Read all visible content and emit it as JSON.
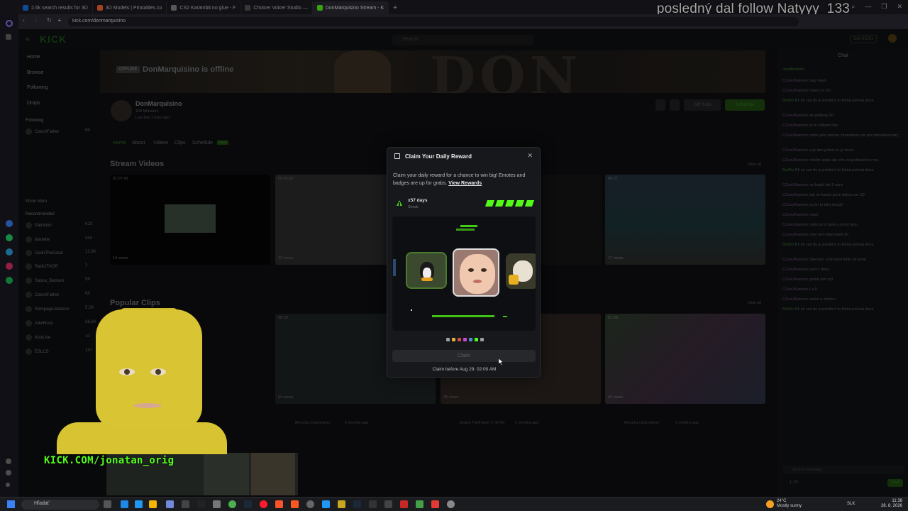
{
  "browser": {
    "tabs": [
      {
        "title": "2.6k search results for 3D",
        "color": "#1a73e8"
      },
      {
        "title": "3D Models | Printables.co",
        "color": "#fa6831"
      },
      {
        "title": "CS2 Karambit no glue - F",
        "color": "#888888"
      },
      {
        "title": "Choicer Voicer Studio —",
        "color": "#555555"
      },
      {
        "title": "DonMarquisino Stream - K",
        "color": "#53fc18"
      }
    ],
    "url": "kick.com/donmarquisino"
  },
  "overlay_text": "posledný dal follow Natyyy_133",
  "site": {
    "logo": "KICK",
    "search_placeholder": "Search",
    "nav": {
      "home": "Home",
      "browse": "Browse",
      "following": "Following",
      "drops": "Drops"
    },
    "following_header": "Following",
    "following": [
      {
        "name": "CzechFather",
        "count": "69"
      }
    ],
    "show_more": "Show More",
    "recommended_header": "Recommended",
    "recommended": [
      {
        "name": "Patrikturi",
        "count": "619"
      },
      {
        "name": "bladette",
        "count": "444"
      },
      {
        "name": "DeanTheGreat",
        "count": "12.8K"
      },
      {
        "name": "RadioTHOR",
        "count": "3"
      },
      {
        "name": "Sasou_Batman",
        "count": "58"
      },
      {
        "name": "CzechFather",
        "count": "68"
      },
      {
        "name": "RampageJackson",
        "count": "5.2K"
      },
      {
        "name": "AdinRoss",
        "count": "28.6K"
      },
      {
        "name": "KickLive",
        "count": "10"
      },
      {
        "name": "ESLCS",
        "count": "147"
      }
    ],
    "channel": {
      "offline_badge": "OFFLINE",
      "offline_title": "DonMarquisino is offline",
      "banner_text": "DON",
      "name": "DonMarquisino",
      "followers": "100 followers",
      "last_live": "Last live 1 hour ago",
      "tabs": [
        "Home",
        "About",
        "Videos",
        "Clips",
        "Schedule"
      ],
      "new_badge": "NEW",
      "gift_subs": "Gift Subs",
      "subscribe": "Subscribe"
    },
    "stream_videos": {
      "title": "Stream Videos",
      "view_all": "View all",
      "items": [
        {
          "duration": "01:07:43",
          "views": "14 views"
        },
        {
          "duration": "05:45:02",
          "views": "33 views"
        },
        {
          "duration": "00:37",
          "views": "17 views"
        }
      ]
    },
    "popular_clips": {
      "title": "Popular Clips",
      "view_all": "View all",
      "items": [
        {
          "duration": "00:30",
          "views": "64 views",
          "tag": "Mencha Chameleon",
          "age": "2 months ago"
        },
        {
          "duration": "",
          "views": "48 views",
          "tag": "Grand Theft Auto V (GTA)",
          "age": "2 months ago"
        },
        {
          "duration": "01:08",
          "views": "42 views",
          "tag": "Mencha Chameleon",
          "age": "2 months ago"
        }
      ]
    },
    "chat": {
      "title": "Chat",
      "pinned": "modifikatutor",
      "messages": [
        {
          "user": "CZvsUKaninec",
          "text": "taky mam"
        },
        {
          "user": "CZvsUKaninec",
          "text": "mam i to 3D"
        },
        {
          "user": "BotRix",
          "text": "Pš mi cez tts a prečita ti to fešná poloná dova"
        },
        {
          "user": "CZvsUKaninec",
          "text": "ze podkrej XD"
        },
        {
          "user": "CZvsUKaninec",
          "text": "je to celkem fajn"
        },
        {
          "user": "CZvsUKaninec",
          "text": "nebo jako mecha chameleon vie jen nahrávka tváry"
        },
        {
          "user": "CZvsUKaninec",
          "text": "a je tam jeden co je tovec"
        },
        {
          "user": "CZvsUKaninec",
          "text": "nevím tadka ale vím ze guildacek to má"
        },
        {
          "user": "BotRix",
          "text": "Pš mi cez tts a prečita ti to fešná poloná dova"
        },
        {
          "user": "CZvsUKaninec",
          "text": "no hojak tak 5 euro"
        },
        {
          "user": "CZvsUKaninec",
          "text": "tak on kazde jsem dobou se XD"
        },
        {
          "user": "CZvsUKaninec",
          "text": "ja jim to taky koupil"
        },
        {
          "user": "CZvsUKaninec",
          "text": "mam"
        },
        {
          "user": "CZvsUKaninec",
          "text": "nebo at to pletu s jinou hrou"
        },
        {
          "user": "CZvsUKaninec",
          "text": "men tam odarnanie 3h"
        },
        {
          "user": "BotRix",
          "text": "Pš mi cez tts a prečita ti to fešná poloná dova"
        },
        {
          "user": "CZvsUKaninec",
          "text": "Species: Unknown tohle by jsme"
        },
        {
          "user": "CZvsUKaninec",
          "text": "jsem i dnes"
        },
        {
          "user": "CZvsUKaninec",
          "text": "petrik tam byl"
        },
        {
          "user": "CZvsUKaninec",
          "text": "j a 9"
        },
        {
          "user": "CZvsUKaninec",
          "text": "zatím a dobrou"
        },
        {
          "user": "BotRix",
          "text": "Pš mi cez tts a prečita ti to fešná poloná dova"
        }
      ],
      "input_placeholder": "Send a message",
      "stat": "1.1K",
      "send_label": "Chat"
    }
  },
  "modal": {
    "title": "Claim Your Daily Reward",
    "description": "Claim your daily reward for a chance to win big! Emotes and badges are up for grabs.",
    "link": "View Rewards",
    "streak_days": "x57 days",
    "streak_label": "Streak",
    "streak_segments": 5,
    "claim_button": "Claim",
    "claim_before": "Claim before Aug 29, 02:00 AM",
    "dot_colors": [
      "#9aa0a6",
      "#e0b03a",
      "#d04b4b",
      "#c44bd0",
      "#4b8cd0",
      "#53fc18",
      "#9aa0a6"
    ],
    "accent": "#53fc18"
  },
  "stream_overlay": {
    "label": "KICK.COM/jonatan_orig"
  },
  "taskbar": {
    "search_placeholder": "Hľadať",
    "weather_temp": "24°C",
    "weather_desc": "Mostly sunny",
    "language": "SLK",
    "time": "11:38",
    "date": "28. 8. 2026"
  }
}
